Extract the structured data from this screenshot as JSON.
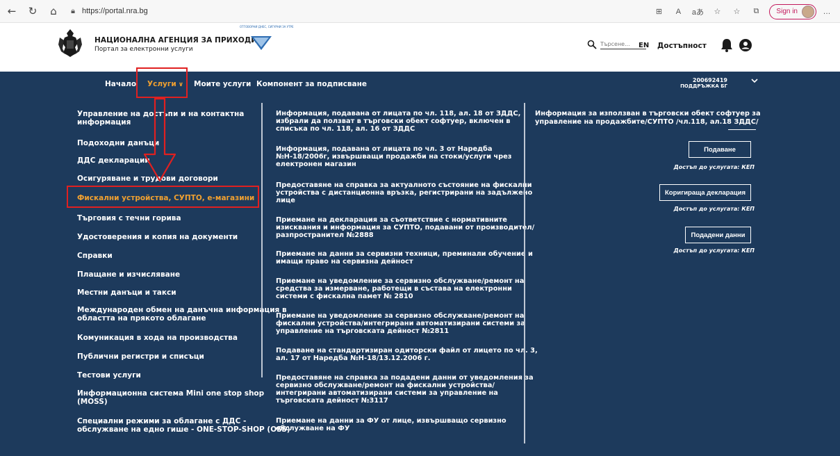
{
  "browser": {
    "url": "https://portal.nra.bg",
    "sign_in_label": "Sign in"
  },
  "header": {
    "agency_name": "НАЦИОНАЛНА АГЕНЦИЯ ЗА ПРИХОДИТЕ",
    "agency_subtitle": "Портал за електронни услуги",
    "emblem_text": "ОТГОВОРНИ ДНЕС, СИГУРНИ ЗА УТРЕ",
    "search_placeholder": "Търсене...",
    "lang": "EN",
    "accessibility": "Достъпност"
  },
  "topnav": {
    "home": "Начало",
    "services": "Услуги",
    "my_services": "Моите услуги",
    "signing_component": "Компонент за подписване"
  },
  "user": {
    "id": "200692419",
    "name": "ПОДДРЪЖКА БГ"
  },
  "categories": [
    "Управление на достъпи и на контактна",
    "информация",
    "Подоходни данъци",
    "ДДС декларации",
    "Осигуряване и трудови договори",
    "Фискални устройства, СУПТО, е-магазини",
    "Търговия с течни горива",
    "Удостоверения и копия на документи",
    "Справки",
    "Плащане и изчисляване",
    "Местни данъци и такси",
    "Международен обмен на данъчна информация в",
    "областта на прякото облагане",
    "Комуникация в хода на производства",
    "Публични регистри и списъци",
    "Тестови услуги",
    "Информационна система Mini one stop shop",
    "(MOSS)",
    "Специални режими за облагане с ДДС -",
    "обслужване на едно гише - ONE-STOP-SHOP (OSS)"
  ],
  "services": [
    "Информация, подавана от лицата по чл. 118, ал. 18 от ЗДДС,",
    "избрали да ползват в търговски обект софтуер, включен в",
    "списъка по чл. 118, ал. 16 от ЗДДС",
    "Информация, подавана от лицата по чл. 3 от Наредба",
    "№Н-18/2006г, извършващи продажби на стоки/услуги чрез",
    "електронен магазин",
    "Предоставяне на справка за актуалното състояние на фискални",
    "устройства с дистанционна връзка, регистрирани на задължено",
    "лице",
    "Приемане на декларация за съответствие с нормативните",
    "изисквания и информация за СУПТО, подавани от производител/",
    "разпространител №2888",
    "Приемане на данни за сервизни техници, преминали обучение и",
    "имащи право на сервизна дейност",
    "Приемане на уведомление за сервизно обслужване/ремонт на",
    "средства за измерване, работещи в състава на електронни",
    "системи с фискална памет № 2810",
    "Приемане на уведомление за сервизно обслужване/ремонт на",
    "фискални устройства/интегрирани автоматизирани системи за",
    "управление на търговската дейност №2811",
    "Подаване на стандартизиран одиторски файл от лицето по чл. 3,",
    "ал. 17 от Наредба №Н-18/13.12.2006 г.",
    "Предоставяне на справка за подадени данни от уведомления за",
    "сервизно обслужване/ремонт на фискални устройства/",
    "интегрирани автоматизирани системи за управление на",
    "търговската дейност №3117",
    "Приемане на данни за ФУ от лице, извършващо сервизно",
    "обслужване на ФУ"
  ],
  "detail": {
    "title_line1": "Информация за използван в търговски обект софтуер за",
    "title_line2": "управление на продажбите/СУПТО /чл.118, ал.18 ЗДДС/",
    "btn_submit": "Подаване",
    "btn_correct": "Коригираща декларация",
    "btn_submitted": "Подадени данни",
    "access_note": "Достъп до услугата: КЕП"
  },
  "colors": {
    "navy": "#1d3a5c",
    "accent": "#f0a030",
    "highlight_box": "#e02020"
  }
}
